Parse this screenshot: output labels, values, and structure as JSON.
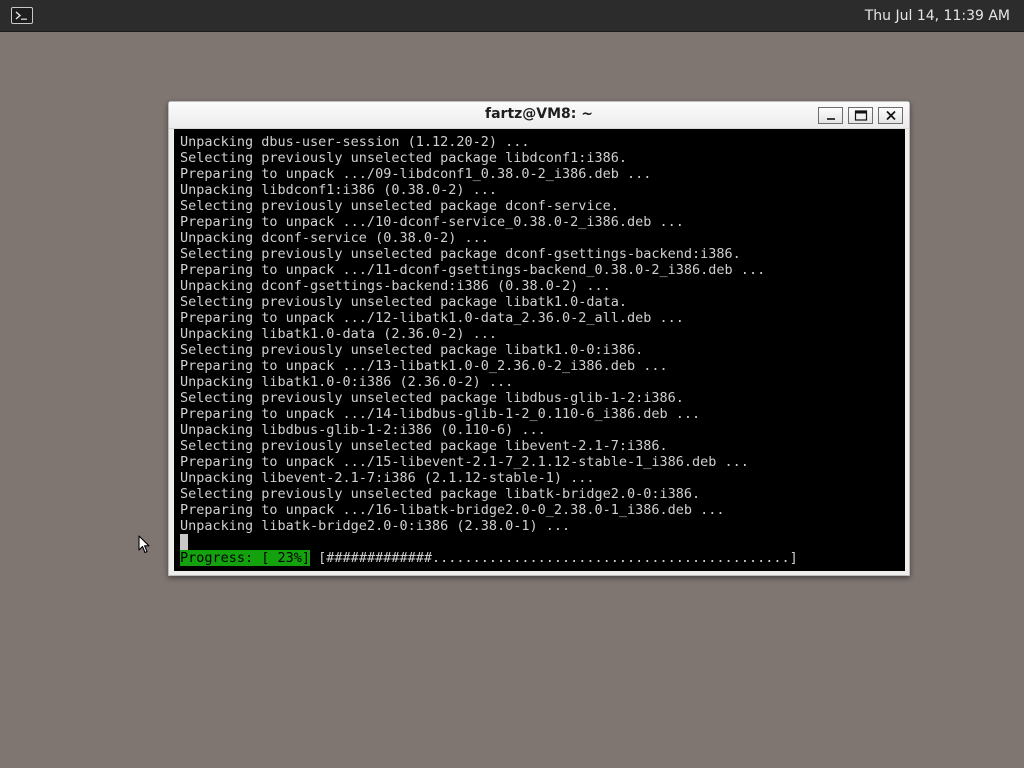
{
  "topbar": {
    "launcher_icon": "terminal-icon",
    "clock": "Thu Jul 14, 11:39 AM"
  },
  "window": {
    "title": "fartz@VM8: ~",
    "controls": {
      "minimize_icon": "minimize-icon",
      "maximize_icon": "maximize-icon",
      "close_icon": "close-icon"
    }
  },
  "terminal": {
    "lines": [
      "Unpacking dbus-user-session (1.12.20-2) ...",
      "Selecting previously unselected package libdconf1:i386.",
      "Preparing to unpack .../09-libdconf1_0.38.0-2_i386.deb ...",
      "Unpacking libdconf1:i386 (0.38.0-2) ...",
      "Selecting previously unselected package dconf-service.",
      "Preparing to unpack .../10-dconf-service_0.38.0-2_i386.deb ...",
      "Unpacking dconf-service (0.38.0-2) ...",
      "Selecting previously unselected package dconf-gsettings-backend:i386.",
      "Preparing to unpack .../11-dconf-gsettings-backend_0.38.0-2_i386.deb ...",
      "Unpacking dconf-gsettings-backend:i386 (0.38.0-2) ...",
      "Selecting previously unselected package libatk1.0-data.",
      "Preparing to unpack .../12-libatk1.0-data_2.36.0-2_all.deb ...",
      "Unpacking libatk1.0-data (2.36.0-2) ...",
      "Selecting previously unselected package libatk1.0-0:i386.",
      "Preparing to unpack .../13-libatk1.0-0_2.36.0-2_i386.deb ...",
      "Unpacking libatk1.0-0:i386 (2.36.0-2) ...",
      "Selecting previously unselected package libdbus-glib-1-2:i386.",
      "Preparing to unpack .../14-libdbus-glib-1-2_0.110-6_i386.deb ...",
      "Unpacking libdbus-glib-1-2:i386 (0.110-6) ...",
      "Selecting previously unselected package libevent-2.1-7:i386.",
      "Preparing to unpack .../15-libevent-2.1-7_2.1.12-stable-1_i386.deb ...",
      "Unpacking libevent-2.1-7:i386 (2.1.12-stable-1) ...",
      "Selecting previously unselected package libatk-bridge2.0-0:i386.",
      "Preparing to unpack .../16-libatk-bridge2.0-0_2.38.0-1_i386.deb ...",
      "Unpacking libatk-bridge2.0-0:i386 (2.38.0-1) ..."
    ],
    "progress_label": "Progress: [ 23%]",
    "progress_bar": " [#############............................................]",
    "progress_percent": 23
  },
  "colors": {
    "desktop": "#7f7672",
    "topbar": "#2c2c2c",
    "terminal_bg": "#000000",
    "terminal_fg": "#d0d0d0",
    "progress_accent": "#13a10e"
  },
  "pointer_icon": "mouse-pointer-icon"
}
